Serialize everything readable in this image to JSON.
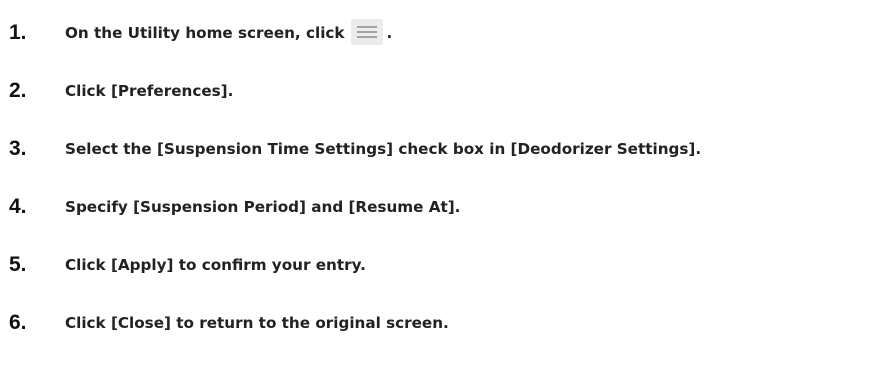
{
  "steps": [
    {
      "number": "1.",
      "text_before": "On the Utility home screen, click",
      "icon": "hamburger-menu-icon",
      "text_after": "."
    },
    {
      "number": "2.",
      "text": "Click [Preferences]."
    },
    {
      "number": "3.",
      "text": "Select the [Suspension Time Settings] check box in [Deodorizer Settings]."
    },
    {
      "number": "4.",
      "text": "Specify [Suspension Period] and [Resume At]."
    },
    {
      "number": "5.",
      "text": "Click [Apply] to confirm your entry."
    },
    {
      "number": "6.",
      "text": "Click [Close] to return to the original screen."
    }
  ]
}
